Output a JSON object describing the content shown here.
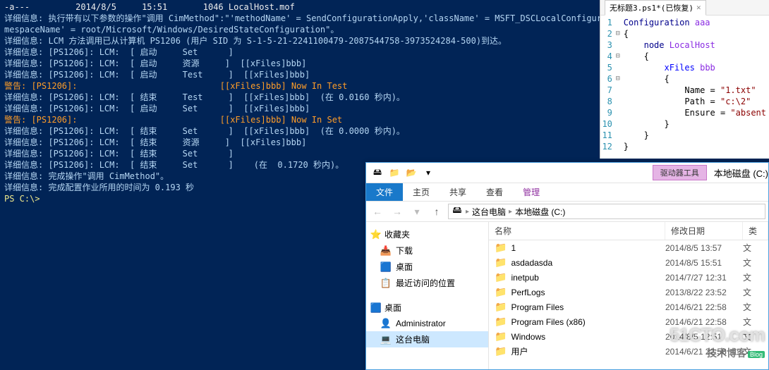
{
  "console": {
    "lines": [
      {
        "cls": "white",
        "text": "-a---         2014/8/5     15:51       1046 LocalHost.mof"
      },
      {
        "cls": "info",
        "text": "详细信息: 执行带有以下参数的操作\"调用 CimMethod\":\"'methodName' = SendConfigurationApply,'className' = MSFT_DSCLocalConfiguratio"
      },
      {
        "cls": "info",
        "text": "mespaceName' = root/Microsoft/Windows/DesiredStateConfiguration\"。"
      },
      {
        "cls": "info",
        "text": "详细信息: LCM 方法调用已从计算机 PS1206 (用户 SID 为 S-1-5-21-2241100479-2087544758-3973524284-500)到达。"
      },
      {
        "cls": "info",
        "text": "详细信息: [PS1206]: LCM:  [ 启动     Set      ]"
      },
      {
        "cls": "info",
        "text": "详细信息: [PS1206]: LCM:  [ 启动     资源     ]  [[xFiles]bbb]"
      },
      {
        "cls": "info",
        "text": "详细信息: [PS1206]: LCM:  [ 启动     Test     ]  [[xFiles]bbb]"
      },
      {
        "cls": "warn",
        "text": "警告: [PS1206]:                            [[xFiles]bbb] Now In Test"
      },
      {
        "cls": "info",
        "text": "详细信息: [PS1206]: LCM:  [ 结束     Test     ]  [[xFiles]bbb]  (在 0.0160 秒内)。"
      },
      {
        "cls": "info",
        "text": "详细信息: [PS1206]: LCM:  [ 启动     Set      ]  [[xFiles]bbb]"
      },
      {
        "cls": "warn",
        "text": "警告: [PS1206]:                            [[xFiles]bbb] Now In Set"
      },
      {
        "cls": "info",
        "text": "详细信息: [PS1206]: LCM:  [ 结束     Set      ]  [[xFiles]bbb]  (在 0.0000 秒内)。"
      },
      {
        "cls": "info",
        "text": "详细信息: [PS1206]: LCM:  [ 结束     资源     ]  [[xFiles]bbb]"
      },
      {
        "cls": "info",
        "text": "详细信息: [PS1206]: LCM:  [ 结束     Set      ]"
      },
      {
        "cls": "info",
        "text": "详细信息: [PS1206]: LCM:  [ 结束     Set      ]    (在  0.1720 秒内)。"
      },
      {
        "cls": "info",
        "text": "详细信息: 完成操作\"调用 CimMethod\"。"
      },
      {
        "cls": "info",
        "text": "详细信息: 完成配置作业所用的时间为 0.193 秒"
      },
      {
        "cls": "white",
        "text": ""
      },
      {
        "cls": "white",
        "text": ""
      },
      {
        "cls": "yellow",
        "text": "PS C:\\> "
      }
    ]
  },
  "editor": {
    "tab_title": "无标题3.ps1*(已恢复)",
    "lines": [
      {
        "n": 1,
        "fold": "",
        "html": "<span class='kw'>Configuration</span> <span class='name'>aaa</span>"
      },
      {
        "n": 2,
        "fold": "⊟",
        "html": "{"
      },
      {
        "n": 3,
        "fold": "",
        "html": "    <span class='kw'>node</span> <span class='name'>LocalHost</span>"
      },
      {
        "n": 4,
        "fold": "⊟",
        "html": "    {"
      },
      {
        "n": 5,
        "fold": "",
        "html": "        <span class='cmd'>xFiles</span> <span class='name'>bbb</span>"
      },
      {
        "n": 6,
        "fold": "⊟",
        "html": "        {"
      },
      {
        "n": 7,
        "fold": "",
        "html": "            Name = <span class='str'>\"1.txt\"</span>"
      },
      {
        "n": 8,
        "fold": "",
        "html": "            Path = <span class='str'>\"c:\\2\"</span>"
      },
      {
        "n": 9,
        "fold": "",
        "html": "            Ensure = <span class='str'>\"absent</span>"
      },
      {
        "n": 10,
        "fold": "",
        "html": "        }"
      },
      {
        "n": 11,
        "fold": "",
        "html": "    }"
      },
      {
        "n": 12,
        "fold": "",
        "html": "}"
      }
    ]
  },
  "explorer": {
    "drivetools": "驱动器工具",
    "window_title": "本地磁盘 (C:)",
    "ribbon": {
      "file": "文件",
      "home": "主页",
      "share": "共享",
      "view": "查看",
      "manage": "管理"
    },
    "breadcrumb": {
      "pc": "这台电脑",
      "drive": "本地磁盘 (C:)"
    },
    "nav": {
      "fav": "收藏夹",
      "dl": "下载",
      "desk": "桌面",
      "recent": "最近访问的位置",
      "deskhead": "桌面",
      "admin": "Administrator",
      "thispc": "这台电脑"
    },
    "cols": {
      "name": "名称",
      "date": "修改日期",
      "type": "类"
    },
    "rows": [
      {
        "name": "1",
        "date": "2014/8/5 13:57",
        "type": "文"
      },
      {
        "name": "asdadasda",
        "date": "2014/8/5 15:51",
        "type": "文"
      },
      {
        "name": "inetpub",
        "date": "2014/7/27 12:31",
        "type": "文"
      },
      {
        "name": "PerfLogs",
        "date": "2013/8/22 23:52",
        "type": "文"
      },
      {
        "name": "Program Files",
        "date": "2014/6/21 22:58",
        "type": "文"
      },
      {
        "name": "Program Files (x86)",
        "date": "2014/6/21 22:58",
        "type": "文"
      },
      {
        "name": "Windows",
        "date": "2014/8/5 12:51",
        "type": "文"
      },
      {
        "name": "用户",
        "date": "2014/6/21 22:58",
        "type": "文"
      }
    ]
  },
  "watermark": {
    "big": "51CTO.com",
    "small": "技术博客",
    "tag": "Blog"
  }
}
